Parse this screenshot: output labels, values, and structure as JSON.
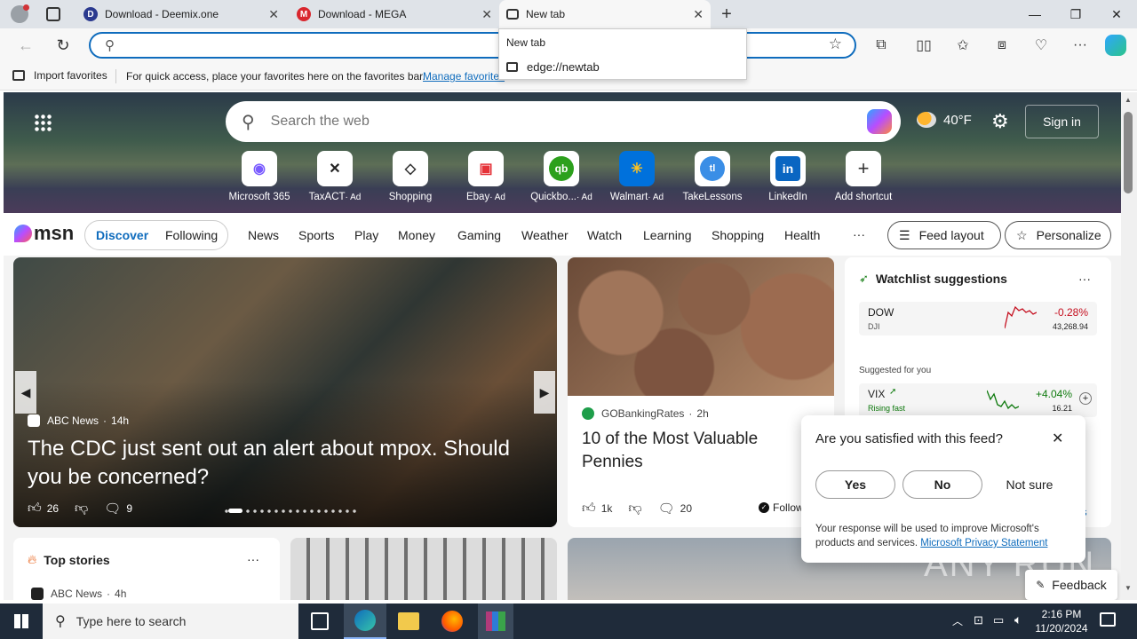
{
  "tabs": [
    {
      "title": "Download - Deemix.one"
    },
    {
      "title": "Download - MEGA"
    },
    {
      "title": "New tab"
    }
  ],
  "address": {
    "value": "",
    "suggestions_header": "New tab",
    "suggestion": "edge://newtab"
  },
  "favbar": {
    "import": "Import favorites",
    "hint": "For quick access, place your favorites here on the favorites bar.",
    "manage": "Manage favorites"
  },
  "hero": {
    "search_placeholder": "Search the web",
    "weather": "40°F",
    "sign_in": "Sign in"
  },
  "shortcuts": [
    {
      "label": "Microsoft 365",
      "ad": false
    },
    {
      "label": "TaxACT",
      "ad": true
    },
    {
      "label": "Shopping",
      "ad": false
    },
    {
      "label": "Ebay",
      "ad": true
    },
    {
      "label": "Quickbo...",
      "ad": true
    },
    {
      "label": "Walmart",
      "ad": true
    },
    {
      "label": "TakeLessons",
      "ad": false
    },
    {
      "label": "LinkedIn",
      "ad": false
    },
    {
      "label": "Add shortcut",
      "ad": false
    }
  ],
  "ad_label": "· Ad",
  "msn": {
    "logo": "msn",
    "discover": "Discover",
    "following": "Following",
    "nav": [
      "News",
      "Sports",
      "Play",
      "Money",
      "Gaming",
      "Weather",
      "Watch",
      "Learning",
      "Shopping",
      "Health"
    ],
    "more": "···",
    "feed_layout": "Feed layout",
    "personalize": "Personalize"
  },
  "main_story": {
    "source": "ABC News",
    "time": "14h",
    "headline": "The CDC just sent out an alert about mpox. Should you be concerned?",
    "likes": "26",
    "comments": "9"
  },
  "second_story": {
    "source": "GOBankingRates",
    "time": "2h",
    "headline": "10 of the Most Valuable Pennies",
    "likes": "1k",
    "comments": "20",
    "follow": "Follow"
  },
  "watchlist": {
    "title": "Watchlist suggestions",
    "more": "···",
    "dow": {
      "name": "DOW",
      "sub": "DJI",
      "change": "-0.28%",
      "value": "43,268.94"
    },
    "suggested": "Suggested for you",
    "vix": {
      "name": "VIX",
      "sub": "Rising fast",
      "change": "+4.04%",
      "value": "16.21"
    },
    "link_tail": "ns"
  },
  "survey": {
    "question": "Are you satisfied with this feed?",
    "yes": "Yes",
    "no": "No",
    "not_sure": "Not sure",
    "note": "Your response will be used to improve Microsoft's products and services.",
    "privacy": "Microsoft Privacy Statement"
  },
  "top_stories": {
    "title": "Top stories",
    "more": "···",
    "source": "ABC News",
    "time": "4h"
  },
  "feedback": "Feedback",
  "watermark": "ANY RUN",
  "taskbar": {
    "search_placeholder": "Type here to search",
    "time": "2:16 PM",
    "date": "11/20/2024"
  },
  "colors": {
    "accent": "#0f6cbd",
    "negative": "#c50f1f",
    "positive": "#0e7a0d",
    "taskbar": "#1f2b3a"
  }
}
